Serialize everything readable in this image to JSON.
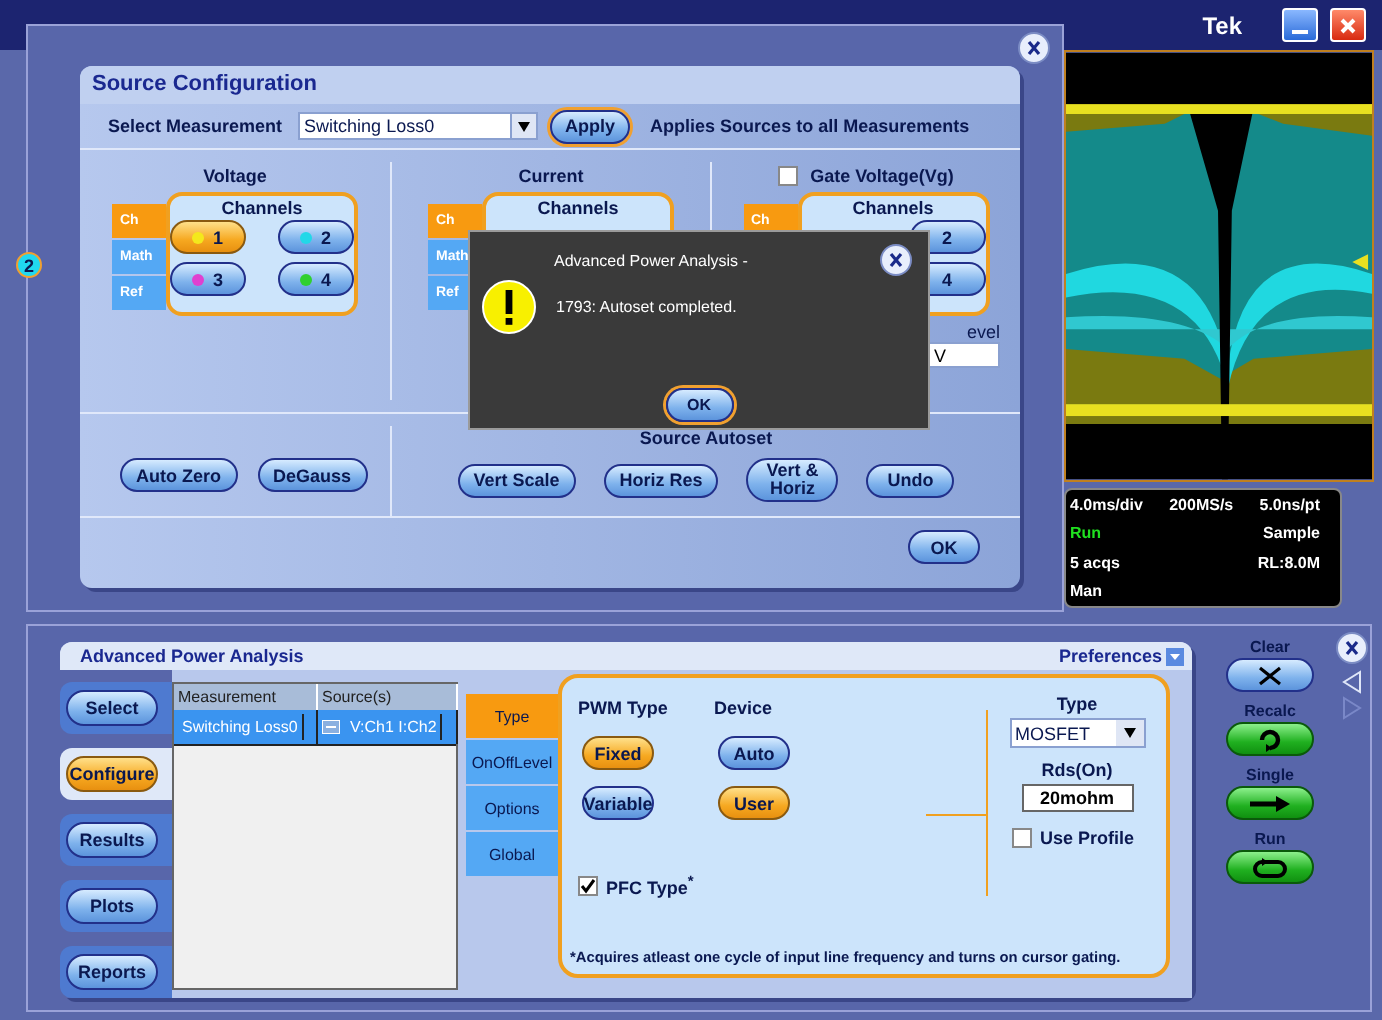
{
  "top_bar": {
    "brand": "Tek"
  },
  "channel_marker": "2",
  "source_config": {
    "title": "Source Configuration",
    "select_label": "Select Measurement",
    "select_value": "Switching Loss0",
    "apply": "Apply",
    "apply_note": "Applies Sources to all Measurements",
    "sections": [
      {
        "kind": "plain",
        "title": "Voltage",
        "source_tabs": [
          {
            "label": "Ch",
            "selected": true
          },
          {
            "label": "Math",
            "selected": false
          },
          {
            "label": "Ref",
            "selected": false
          }
        ],
        "channels_title": "Channels",
        "channels": [
          {
            "label": "1",
            "color": "#f4e81c",
            "selected": true
          },
          {
            "label": "2",
            "color": "#22d8e8",
            "selected": false
          },
          {
            "label": "3",
            "color": "#e040d0",
            "selected": false
          },
          {
            "label": "4",
            "color": "#30d030",
            "selected": false
          }
        ]
      },
      {
        "kind": "plain",
        "title": "Current",
        "source_tabs": [
          {
            "label": "Ch",
            "selected": true
          },
          {
            "label": "Math",
            "selected": false
          },
          {
            "label": "Ref",
            "selected": false
          }
        ],
        "channels_title": "Channels"
      },
      {
        "kind": "checkbox",
        "title": "Gate Voltage(Vg)",
        "checked": false,
        "source_tabs": [
          {
            "label": "Ch",
            "selected": true
          }
        ],
        "channels_title": "Channels",
        "channels": [
          {
            "label": "2",
            "selected": false
          },
          {
            "label": "4",
            "selected": false
          }
        ],
        "level": {
          "label": "evel",
          "value": "V"
        }
      }
    ],
    "left_buttons": [
      "Auto Zero",
      "DeGauss"
    ],
    "autoset": {
      "title": "Source Autoset",
      "buttons": [
        "Vert Scale",
        "Horiz Res",
        "Vert & Horiz",
        "Undo"
      ]
    },
    "ok": "OK"
  },
  "dialog": {
    "title": "Advanced Power Analysis -",
    "message": "1793: Autoset completed.",
    "ok": "OK"
  },
  "readout": [
    [
      {
        "text": "4.0ms/div",
        "kind": "value"
      },
      {
        "text": "200MS/s",
        "kind": "value"
      },
      {
        "text": "5.0ns/pt",
        "kind": "value"
      }
    ],
    [
      {
        "text": "Run",
        "kind": "state"
      },
      {
        "text": "Sample",
        "kind": "value"
      }
    ],
    [
      {
        "text": "5 acqs",
        "kind": "value"
      },
      {
        "text": "RL:8.0M",
        "kind": "value"
      }
    ],
    [
      {
        "text": "Man",
        "kind": "value"
      }
    ]
  ],
  "apa": {
    "title": "Advanced Power Analysis",
    "preferences": "Preferences",
    "nav": [
      {
        "label": "Select",
        "selected": false
      },
      {
        "label": "Configure",
        "selected": true
      },
      {
        "label": "Results",
        "selected": false
      },
      {
        "label": "Plots",
        "selected": false
      },
      {
        "label": "Reports",
        "selected": false
      }
    ],
    "table": {
      "columns": [
        "Measurement",
        "Source(s)"
      ],
      "rows": [
        {
          "cells": [
            "Switching Loss0",
            "V:Ch1 I:Ch2"
          ],
          "selected": true
        }
      ]
    },
    "tabs": [
      {
        "label": "Type",
        "selected": true
      },
      {
        "label": "OnOffLevel",
        "selected": false
      },
      {
        "label": "Options",
        "selected": false
      },
      {
        "label": "Global",
        "selected": false
      }
    ],
    "pwm": {
      "title": "PWM Type",
      "options": [
        {
          "label": "Fixed",
          "selected": true
        },
        {
          "label": "Variable",
          "selected": false
        }
      ]
    },
    "device": {
      "title": "Device",
      "options": [
        {
          "label": "Auto",
          "selected": false
        },
        {
          "label": "User",
          "selected": true
        }
      ]
    },
    "pfc": {
      "label": "PFC Type$^{*}$",
      "checked": true
    },
    "type": {
      "label": "Type",
      "value": "MOSFET"
    },
    "rds": {
      "label": "Rds(On)",
      "value": "20mohm"
    },
    "use_profile": {
      "label": "Use Profile",
      "checked": false
    },
    "footnote": "*Acquires atleast one cycle of input line frequency and turns on cursor gating.",
    "actions": [
      {
        "label": "Clear",
        "kind": "clear"
      },
      {
        "label": "Recalc",
        "kind": "recalc"
      },
      {
        "label": "Single",
        "kind": "single"
      },
      {
        "label": "Run",
        "kind": "run"
      }
    ]
  }
}
